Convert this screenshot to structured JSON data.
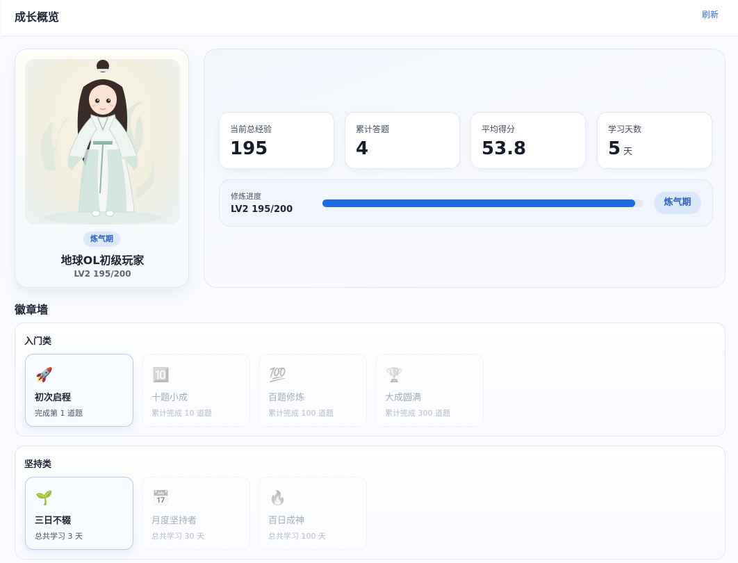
{
  "header": {
    "title": "成长概览",
    "refresh_label": "刷新"
  },
  "profile": {
    "realm_badge": "炼气期",
    "name": "地球OL初级玩家",
    "level_text": "LV2 195/200",
    "avatar_icon": "cultivator-girl-illustration"
  },
  "stats": [
    {
      "label": "当前总经验",
      "value": "195",
      "unit": ""
    },
    {
      "label": "累计答题",
      "value": "4",
      "unit": ""
    },
    {
      "label": "平均得分",
      "value": "53.8",
      "unit": ""
    },
    {
      "label": "学习天数",
      "value": "5",
      "unit": "天"
    }
  ],
  "progress": {
    "label": "修炼进度",
    "value_text": "LV2 195/200",
    "fraction": 0.975,
    "realm": "炼气期",
    "bar_color": "#1f6be0"
  },
  "badges": {
    "title": "徽章墙",
    "groups": [
      {
        "title": "入门类",
        "items": [
          {
            "icon": "rocket-icon",
            "glyph": "🚀",
            "name": "初次启程",
            "desc": "完成第 1 道题",
            "unlocked": true
          },
          {
            "icon": "ten-icon",
            "glyph": "🔟",
            "name": "十题小成",
            "desc": "累计完成 10 道题",
            "unlocked": false
          },
          {
            "icon": "hundred-icon",
            "glyph": "💯",
            "name": "百题修炼",
            "desc": "累计完成 100 道题",
            "unlocked": false
          },
          {
            "icon": "trophy-icon",
            "glyph": "🏆",
            "name": "大成圆满",
            "desc": "累计完成 300 道题",
            "unlocked": false
          }
        ]
      },
      {
        "title": "坚持类",
        "items": [
          {
            "icon": "seedling-icon",
            "glyph": "🌱",
            "name": "三日不辍",
            "desc": "总共学习 3 天",
            "unlocked": true
          },
          {
            "icon": "calendar-icon",
            "glyph": "📅",
            "name": "月度坚持者",
            "desc": "总共学习 30 天",
            "unlocked": false
          },
          {
            "icon": "flame-icon",
            "glyph": "🔥",
            "name": "百日成神",
            "desc": "总共学习 100 天",
            "unlocked": false
          }
        ]
      }
    ]
  }
}
